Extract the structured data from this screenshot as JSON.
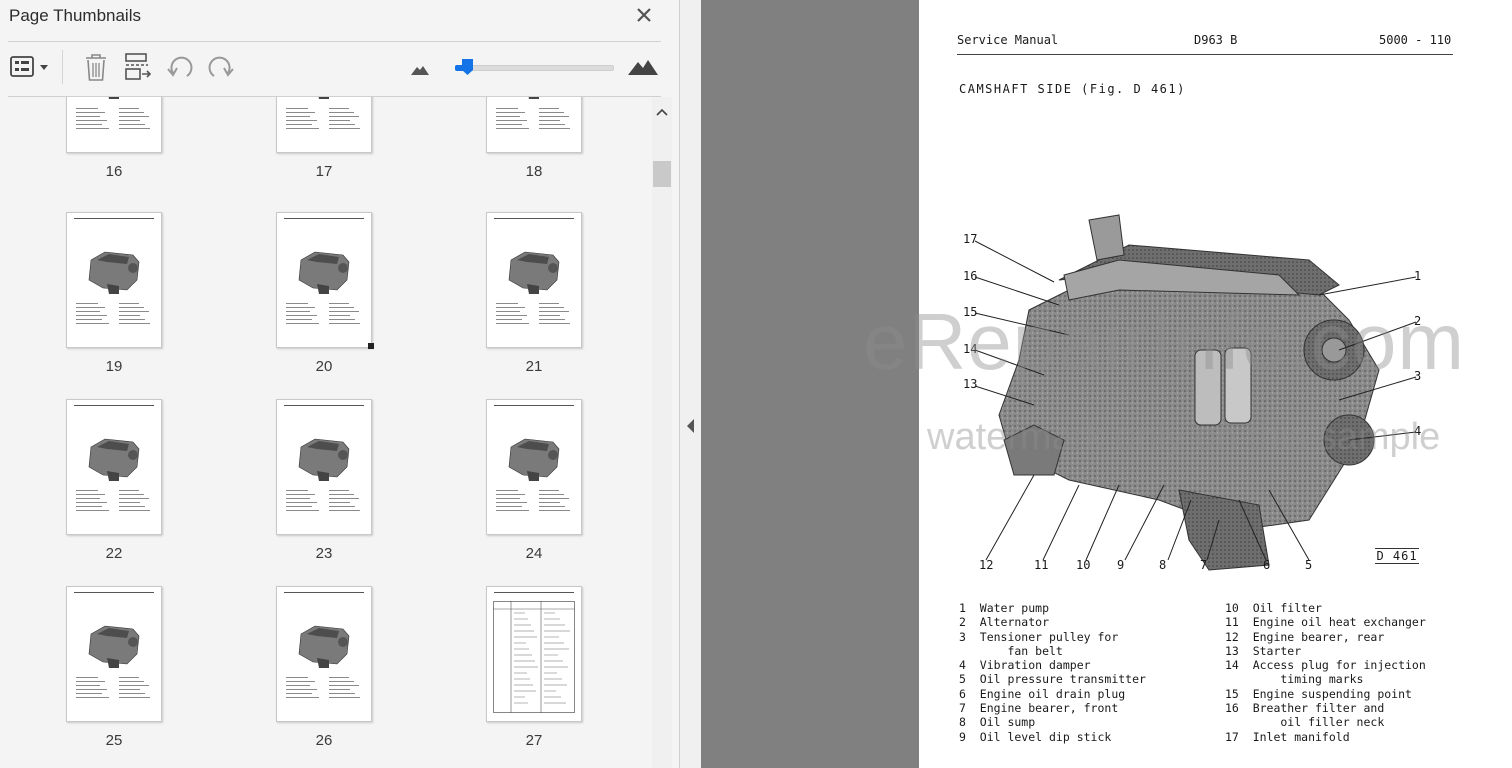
{
  "panel": {
    "title": "Page Thumbnails",
    "toolbar": {
      "options_icon": "thumbnail-options-icon",
      "delete_icon": "trash-icon",
      "extract_icon": "extract-pages-icon",
      "rotate_ccw_icon": "rotate-counterclockwise-icon",
      "rotate_cw_icon": "rotate-clockwise-icon",
      "zoom_out_icon": "small-mountain-icon",
      "zoom_in_icon": "large-mountain-icon",
      "zoom_level": 0.04
    },
    "thumbnails": [
      "16",
      "17",
      "18",
      "19",
      "20",
      "21",
      "22",
      "23",
      "24",
      "25",
      "26",
      "27"
    ]
  },
  "document": {
    "header_left": "Service Manual",
    "header_mid": "D963 B",
    "header_right": "5000 - 110",
    "section_title": "CAMSHAFT SIDE (Fig. D 461)",
    "figure_label": "D 461",
    "callouts": [
      "1",
      "2",
      "3",
      "4",
      "5",
      "6",
      "7",
      "8",
      "9",
      "10",
      "11",
      "12",
      "13",
      "14",
      "15",
      "16",
      "17"
    ],
    "legend_left": [
      "1  Water pump",
      "2  Alternator",
      "3  Tensioner pulley for",
      "       fan belt",
      "4  Vibration damper",
      "5  Oil pressure transmitter",
      "6  Engine oil drain plug",
      "7  Engine bearer, front",
      "8  Oil sump",
      "9  Oil level dip stick"
    ],
    "legend_right": [
      "10  Oil filter",
      "11  Engine oil heat exchanger",
      "12  Engine bearer, rear",
      "13  Starter",
      "14  Access plug for injection",
      "        timing marks",
      "15  Engine suspending point",
      "16  Breather filter and",
      "        oil filler neck",
      "17  Inlet manifold"
    ],
    "watermark_main": "eRepairInfo.com",
    "watermark_sub": "watermark only on this sample"
  },
  "colors": {
    "accent": "#1473e6",
    "viewer_bg": "#808080",
    "panel_bg": "#f4f4f4"
  }
}
